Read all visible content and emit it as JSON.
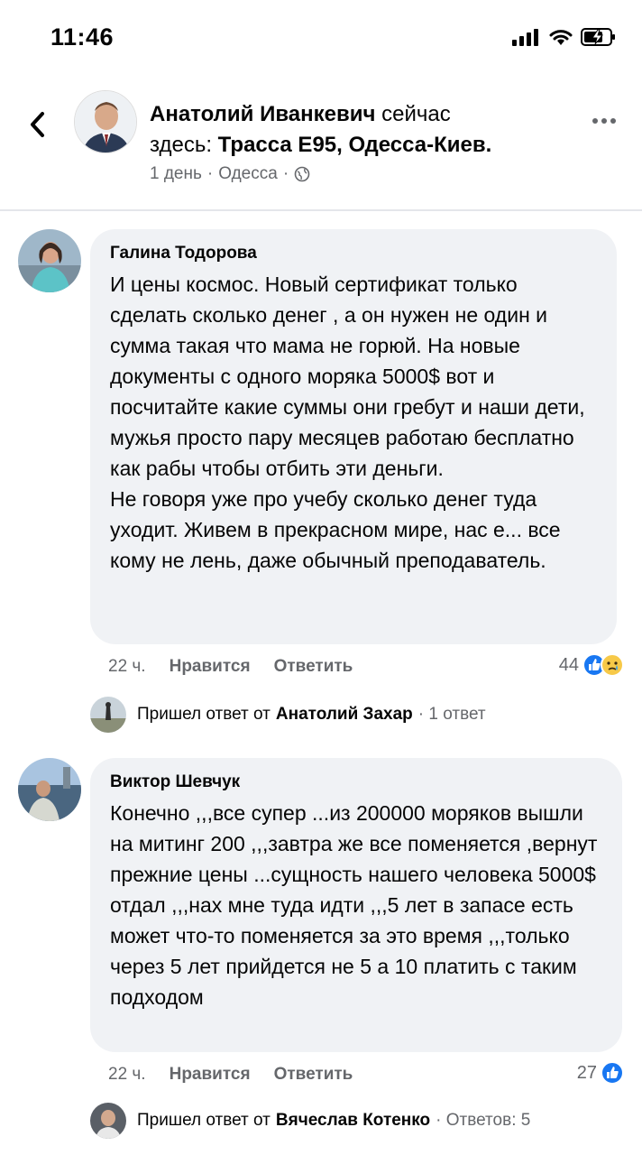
{
  "status": {
    "time": "11:46"
  },
  "header": {
    "author": "Анатолий Иванкевич",
    "verb": "сейчас",
    "place_prefix": "здесь:",
    "place": "Трасса E95, Одесса-Киев.",
    "time": "1 день",
    "location": "Одесса"
  },
  "comments": [
    {
      "author": "Галина Тодорова",
      "text": "И цены космос. Новый сертификат только сделать сколько денег , а он нужен не один и сумма такая что мама не горюй. На новые документы с одного моряка 5000$ вот и посчитайте какие суммы они гребут и наши дети, мужья просто пару месяцев работаю бесплатно как рабы чтобы отбить эти деньги.\nНе говоря уже про учебу сколько денег туда уходит. Живем в прекрасном мире, нас е... все кому не лень, даже обычный преподаватель.",
      "time": "22 ч.",
      "like": "Нравится",
      "reply": "Ответить",
      "reactions": "44",
      "reply_prefix": "Пришел ответ от",
      "reply_author": "Анатолий Захар",
      "reply_count": "· 1 ответ"
    },
    {
      "author": "Виктор Шевчук",
      "text": "Конечно ,,,все супер ...из 200000 моряков вышли на митинг 200 ,,,завтра же все поменяется ,вернут прежние цены ...сущность нашего человека 5000$ отдал ,,,нах мне туда идти ,,,5 лет в запасе есть может что-то поменяется за это время ,,,только через 5 лет прийдется не 5 а 10 платить с таким подходом",
      "time": "22 ч.",
      "like": "Нравится",
      "reply": "Ответить",
      "reactions": "27",
      "reply_prefix": "Пришел ответ от",
      "reply_author": "Вячеслав Котенко",
      "reply_count": "· Ответов: 5"
    }
  ],
  "colors": {
    "accent": "#1877f2",
    "bubble": "#f0f2f5",
    "meta": "#65676b"
  },
  "icons": [
    "back-icon",
    "more-icon",
    "globe-icon",
    "like-reaction-icon",
    "sad-reaction-icon",
    "signal-icon",
    "wifi-icon",
    "battery-icon"
  ]
}
